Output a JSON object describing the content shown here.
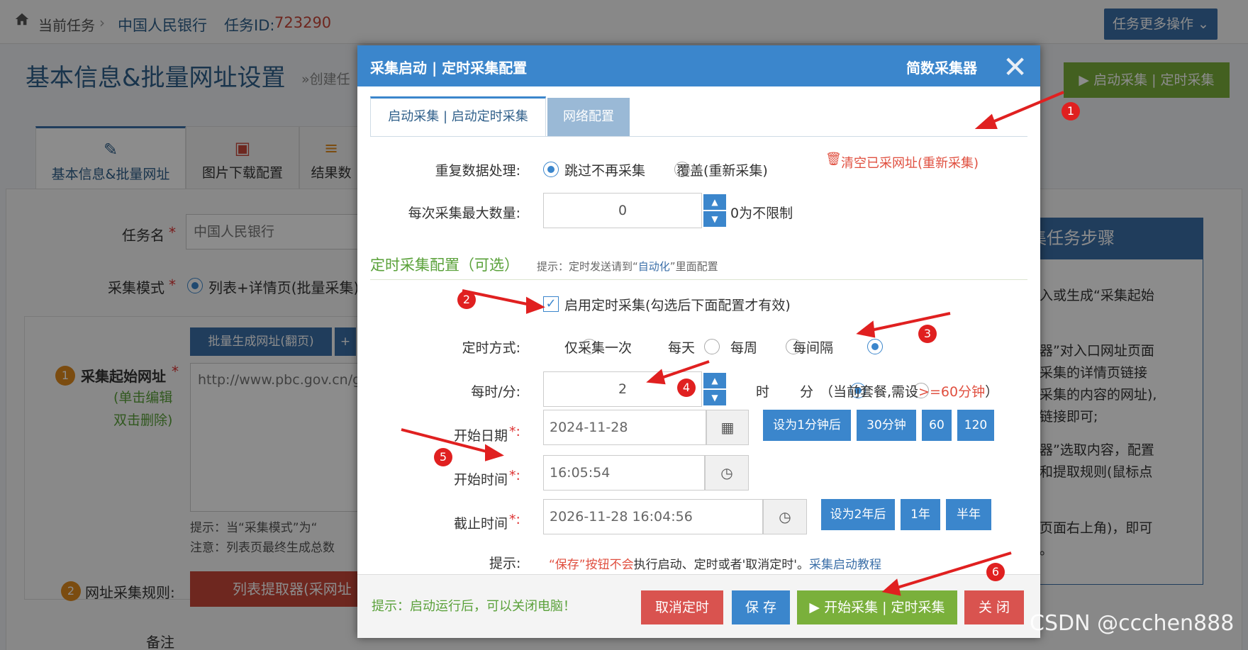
{
  "breadcrumb": {
    "current": "当前任务",
    "sep": "›",
    "task_name": "中国人民银行",
    "task_id_label": "任务ID:",
    "task_id": "723290"
  },
  "more_ops": "任务更多操作 ⌄",
  "page": {
    "title": "基本信息&批量网址设置",
    "subtitle": "»创建任",
    "start_button": "▶ 启动采集 | 定时采集"
  },
  "bg_tabs": [
    {
      "icon": "edit-icon",
      "label": "基本信息&批量网址"
    },
    {
      "icon": "image-icon",
      "label": "图片下载配置"
    },
    {
      "icon": "database-icon",
      "label": "结果数"
    }
  ],
  "bg_form": {
    "task_name_label": "任务名",
    "task_name_value": "中国人民银行",
    "mode_label": "采集模式",
    "mode_value": "列表+详情页(批量采集)",
    "batch_btn": "批量生成网址(翻页)",
    "start_url_label": "采集起始网址",
    "start_url_note1": "(单击编辑",
    "start_url_note2": "双击删除)",
    "start_url_value": "http://www.pbc.gov.cn/g",
    "tip1": "提示：当“采集模式”为“",
    "tip2": "注意：列表页最终生成总数",
    "rule_label": "网址采集规则:",
    "rule_btn": "列表提取器(采网址",
    "note_label": "备注"
  },
  "steps": {
    "head": "集任务步骤",
    "lines": [
      "输入或生成“采集起始",
      "",
      "取器”对入口网址页面",
      "要采集的详情页链接",
      "要采集的内容的网址),",
      "同链接即可;",
      "",
      "取器”选取内容，配置",
      "段和提取规则(鼠标点",
      "",
      "",
      "务页面右上角)，即可",
      "据。"
    ]
  },
  "modal": {
    "title": "采集启动 | 定时采集配置",
    "brand": "简数采集器",
    "close": "✕",
    "tabs": [
      "启动采集 | 启动定时采集",
      "网络配置"
    ],
    "dup_label": "重复数据处理:",
    "dup_opt1": "跳过不再采集",
    "dup_opt2": "覆盖(重新采集)",
    "clear_link": "清空已采网址(重新采集)",
    "max_label": "每次采集最大数量:",
    "max_value": "0",
    "max_hint": "0为不限制",
    "sched_title": "定时采集配置（可选）",
    "sched_hint_pre": "提示：定时发送请到“",
    "sched_hint_link": "自动化",
    "sched_hint_post": "”里面配置",
    "enable_label": "启用定时采集(勾选后下面配置才有效)",
    "mode_label": "定时方式:",
    "mode_opts": [
      "仅采集一次",
      "每天",
      "每周",
      "每间隔"
    ],
    "interval_label": "每时/分:",
    "interval_value": "2",
    "unit_hour": "时",
    "unit_min": "分",
    "unit_note_pre": "（当前套餐,需设",
    "unit_note_red": ">=60分钟",
    "unit_note_post": "）",
    "start_date_label": "开始日期",
    "start_date_value": "2024-11-28",
    "date_btns": [
      "设为1分钟后",
      "30分钟",
      "60",
      "120"
    ],
    "start_time_label": "开始时间",
    "start_time_value": "16:05:54",
    "end_time_label": "截止时间",
    "end_time_value": "2026-11-28 16:04:56",
    "end_btns": [
      "设为2年后",
      "1年",
      "半年"
    ],
    "tip_label": "提示:",
    "tip_red": "“保存”按钮不会",
    "tip_mid": "执行启动、定时或者'取消定时'。",
    "tip_link": "采集启动教程",
    "foot_hint": "提示：启动运行后，可以关闭电脑！",
    "btn_cancel_sched": "取消定时",
    "btn_save": "保 存",
    "btn_start": "▶ 开始采集 | 定时采集",
    "btn_close": "关 闭"
  },
  "annotations": [
    "1",
    "2",
    "3",
    "4",
    "5",
    "6"
  ],
  "watermark": "CSDN @ccchen888"
}
